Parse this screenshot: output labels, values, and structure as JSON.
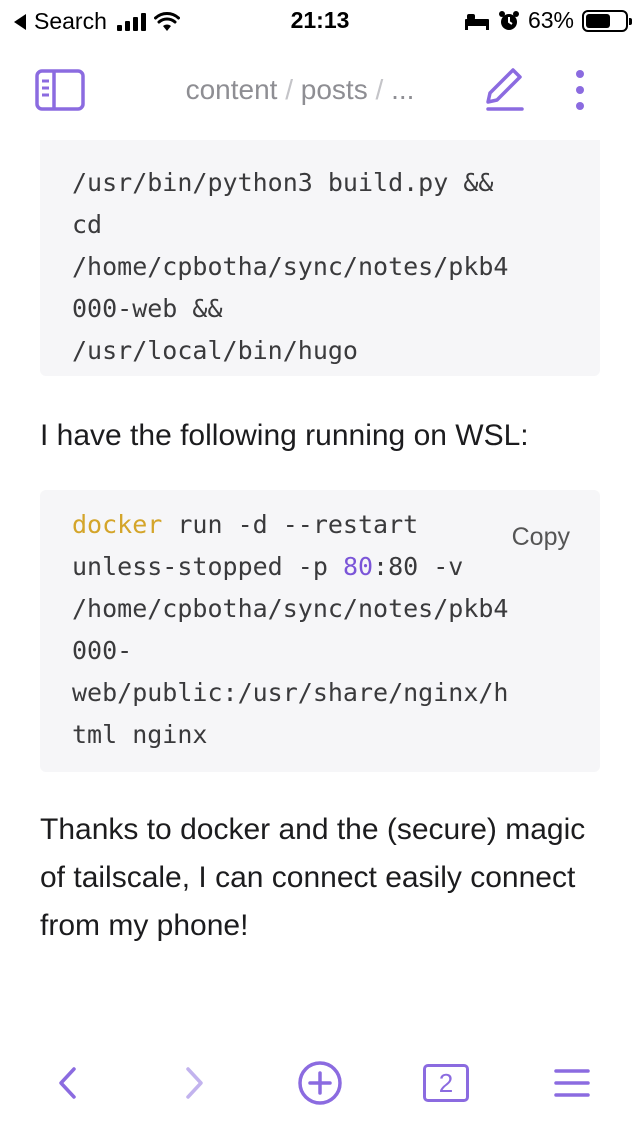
{
  "status_bar": {
    "back_label": "Search",
    "time": "21:13",
    "battery": "63%",
    "battery_level": 0.63
  },
  "header": {
    "path": [
      "content",
      "posts",
      "..."
    ],
    "icons": [
      "sidebar-icon",
      "edit-pencil-icon",
      "more-vertical-icon"
    ]
  },
  "article": {
    "code_block_1": {
      "lines": [
        "/usr/bin/python3 build.py &&",
        "cd",
        "/home/cpbotha/sync/notes/pkb4",
        "000-web &&",
        "/usr/local/bin/hugo"
      ]
    },
    "paragraph_1": "I have the following running on WSL:",
    "code_block_2": {
      "copy_label": "Copy",
      "line_1_keyword": "docker",
      "line_1_rest": " run -d --restart",
      "line_2_pre": "unless-stopped -p ",
      "line_2_num": "80",
      "line_2_post": ":80 -v",
      "line_3": "/home/cpbotha/sync/notes/pkb4",
      "line_4": "000-",
      "line_5": "web/public:/usr/share/nginx/h",
      "line_6": "tml nginx"
    },
    "paragraph_2": "Thanks to docker and the (secure) magic of tailscale, I can connect easily connect from my phone!"
  },
  "toolbar": {
    "tabs_count": "2",
    "icons": [
      "back-icon",
      "forward-icon",
      "new-note-icon",
      "tabs-icon",
      "menu-icon"
    ]
  },
  "colors": {
    "accent": "#8b6be0",
    "code_bg": "#f6f6f8",
    "keyword": "#d4a52a",
    "number": "#7b55d8",
    "muted": "#8e8e93"
  }
}
